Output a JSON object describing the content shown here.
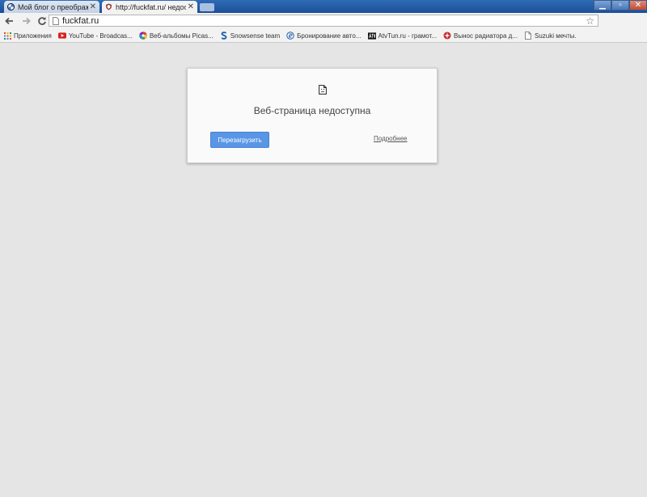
{
  "tabs": [
    {
      "title": "Мой блог о преображен",
      "active": false
    },
    {
      "title": "http://fuckfat.ru/ недосту",
      "active": true
    }
  ],
  "window": {
    "minimize": "▁",
    "maximize": "▫",
    "close": "✕"
  },
  "toolbar": {
    "url": "fuckfat.ru",
    "back_icon": "back-arrow-icon",
    "forward_icon": "forward-arrow-icon",
    "reload_icon": "reload-icon"
  },
  "bookmarks": [
    {
      "label": "Приложения",
      "icon": "apps-grid-icon"
    },
    {
      "label": "YouTube - Broadcas...",
      "icon": "youtube-icon"
    },
    {
      "label": "Веб-альбомы Picas...",
      "icon": "picasa-icon"
    },
    {
      "label": "Snowsense team",
      "icon": "snowsense-icon"
    },
    {
      "label": "Бронирование авто...",
      "icon": "booking-icon"
    },
    {
      "label": "AtvTun.ru - грамот...",
      "icon": "atv-icon"
    },
    {
      "label": "Вынос радиатора д...",
      "icon": "radiator-icon"
    },
    {
      "label": "Suzuki мечты.",
      "icon": "page-icon"
    }
  ],
  "error": {
    "title": "Веб-страница недоступна",
    "reload_label": "Перезагрузить",
    "details_label": "Подробнее"
  },
  "colors": {
    "accent": "#5a96e6",
    "titlebar": "#1c4f98"
  }
}
